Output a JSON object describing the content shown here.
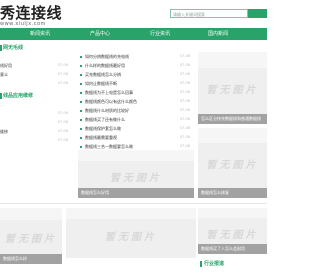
{
  "header": {
    "logo_text": "秀连接线",
    "logo_sub": "www.xiuljx.com",
    "search_placeholder": "请输入关键词搜索"
  },
  "nav": {
    "items": [
      "新闻资讯",
      "产品中心",
      "行业资讯",
      "国内新闻"
    ]
  },
  "left": {
    "section1_title": "网无毛线",
    "section1_items": [
      {
        "text": "...",
        "date": "",
        "faint": true
      },
      {
        "text": "线好用",
        "date": "07-06"
      },
      {
        "text": "意义",
        "date": "07-06"
      },
      {
        "text": "",
        "date": "07-06"
      }
    ],
    "section2_title": "线品应用维修",
    "section2_items": [
      {
        "text": "...",
        "date": "",
        "faint": true
      },
      {
        "text": "",
        "date": "07-06"
      },
      {
        "text": "",
        "date": "07-06"
      },
      {
        "text": "维修",
        "date": "07-06"
      },
      {
        "text": "",
        "date": "07-06"
      }
    ]
  },
  "main_list": [
    {
      "text": "如何分辨数据线的充电线",
      "date": "07-06"
    },
    {
      "text": "什么样的数据线最好用",
      "date": "07-06"
    },
    {
      "text": "买充数据线怎么分辨",
      "date": "07-06"
    },
    {
      "text": "如何让数据线不断",
      "date": "07-06"
    },
    {
      "text": "数据线为不上电是怎么回事",
      "date": "07-06"
    },
    {
      "text": "数据线颜色可以有这什么颜色",
      "date": "07-06"
    },
    {
      "text": "数据线什么材质的比较好",
      "date": "07-06"
    },
    {
      "text": "数据线买了还有做什么",
      "date": "07-06"
    },
    {
      "text": "数据线保护套怎么做",
      "date": "07-06"
    },
    {
      "text": "数据线最需要重视",
      "date": "07-06"
    },
    {
      "text": "数据线三合一数据要怎么做",
      "date": "07-06"
    }
  ],
  "thumbs": {
    "placeholder": "暂无图片",
    "right_top_caption": "怎么区分快充数据线和普通数据线",
    "right_mid_caption": "数据线怎么修复",
    "left_mid_caption": "数据线怎么好用",
    "bottom_right_caption": "数据线买了人怎么会耐用"
  },
  "bottom": {
    "left_caption": "数据线怎么样",
    "right_section_title": "行业报道"
  },
  "colors": {
    "brand": "#2aa36b",
    "divider": "#e6e6e6"
  }
}
